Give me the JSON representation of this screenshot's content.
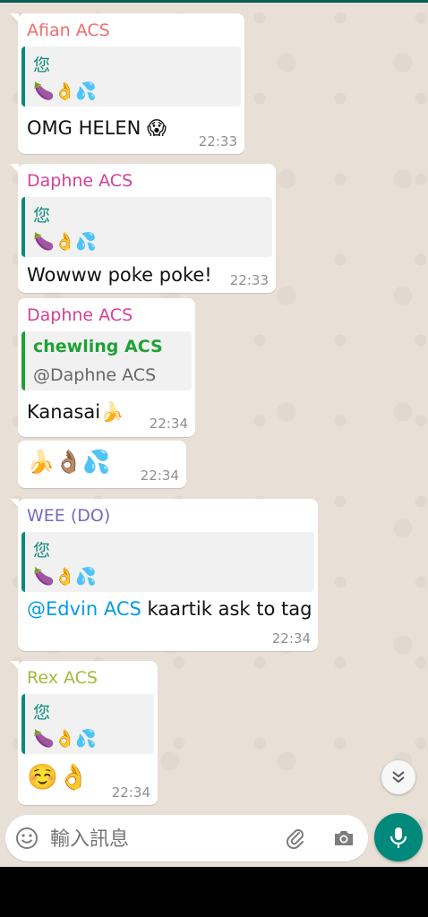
{
  "colors": {
    "sender_afian": "#f06d6d",
    "sender_daphne": "#d63f96",
    "sender_wee": "#7a68c0",
    "sender_rex": "#a7b83a",
    "quote_author_green": "#1fa137",
    "quote_border_teal": "#0b8a7a",
    "quote_border_green": "#1fa137",
    "mic_button": "#00897b"
  },
  "messages": [
    {
      "sender": "Afian ACS",
      "quote": {
        "line1": "您",
        "line2": "🍆👌💦"
      },
      "text": "OMG HELEN 😱",
      "time": "22:33"
    },
    {
      "sender": "Daphne ACS",
      "quote": {
        "line1": "您",
        "line2": "🍆👌💦"
      },
      "text": "Wowww poke poke!",
      "time": "22:33"
    },
    {
      "sender": "Daphne ACS",
      "quote": {
        "line1": "chewling ACS",
        "line2": "@Daphne ACS"
      },
      "text": "Kanasai🍌",
      "time": "22:34"
    },
    {
      "text": "🍌👌🏽💦",
      "time": "22:34"
    },
    {
      "sender": "WEE (DO)",
      "quote": {
        "line1": "您",
        "line2": "🍆👌💦"
      },
      "mention": "@Edvin ACS",
      "text": " kaartik ask to tag",
      "time": "22:34"
    },
    {
      "sender": "Rex ACS",
      "quote": {
        "line1": "您",
        "line2": "🍆👌💦"
      },
      "text": "☺️👌",
      "time": "22:34"
    }
  ],
  "input": {
    "placeholder": "輸入訊息",
    "emoji_icon": "smiley-icon",
    "attach_icon": "paperclip-icon",
    "camera_icon": "camera-icon",
    "mic_icon": "microphone-icon"
  },
  "scroll_icon": "double-chevron-down-icon"
}
